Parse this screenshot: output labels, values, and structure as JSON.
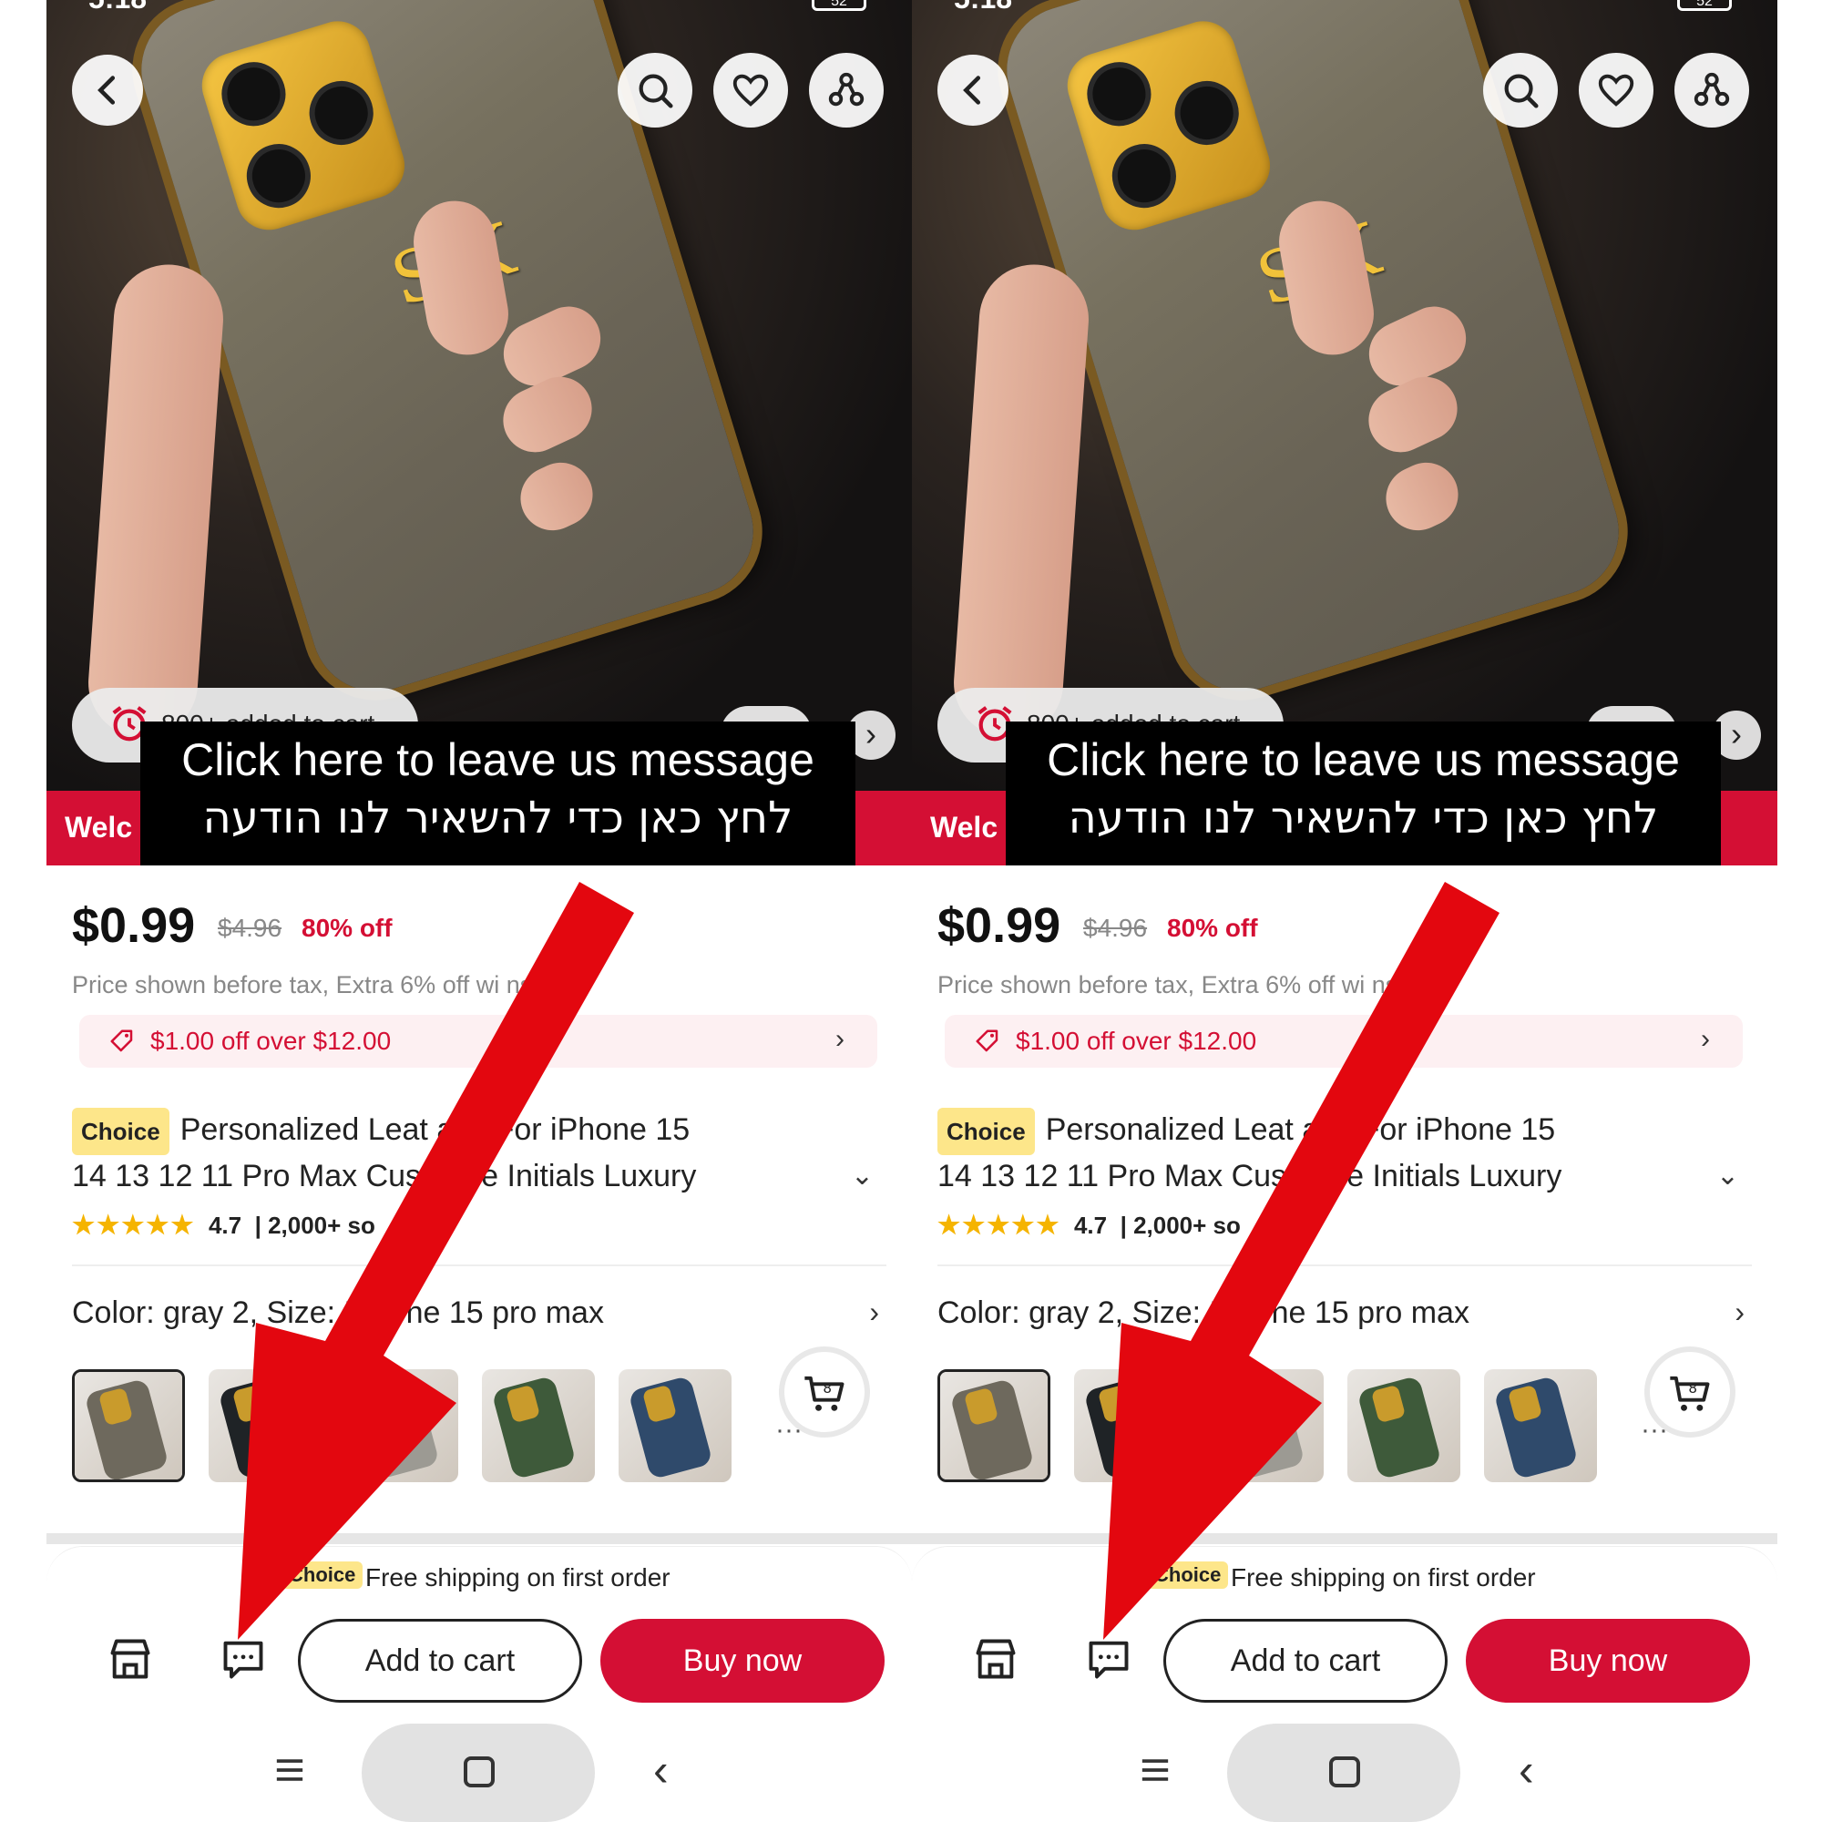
{
  "status": {
    "time": "5:18",
    "battery": "52"
  },
  "overlay": {
    "line1": "Click here to leave us message",
    "line2": "לחץ כאן כדי להשאיר לנו הודעה"
  },
  "hero": {
    "initials": "S.K",
    "added_to_cart": "800+ added to cart",
    "welcome": "Welc"
  },
  "product": {
    "price": "$0.99",
    "original_price": "$4.96",
    "discount": "80% off",
    "tax_note": "Price shown before tax, Extra 6% off wi                    ns",
    "coupon": "$1.00 off over $12.00",
    "choice_label": "Choice",
    "title_line1": "Personalized Leat        ase For iPhone 15",
    "title_line2": "14 13 12 11 Pro Max Custo        me Initials Luxury",
    "rating": "4.7",
    "sold": "2,000+ so",
    "variant": "Color: gray 2, Size: F        hone 15 pro max",
    "cart_count": "8"
  },
  "shipping": {
    "choice_label": "Choice",
    "text": "Free shipping on first order"
  },
  "actions": {
    "add_to_cart": "Add to cart",
    "buy_now": "Buy now"
  },
  "thumb_colors": [
    "#6e695d",
    "#1f2326",
    "#9c9a93",
    "#3e5a3a",
    "#2f4a6b"
  ],
  "colors": {
    "accent": "#d40f34",
    "arrow": "#e3070f"
  }
}
